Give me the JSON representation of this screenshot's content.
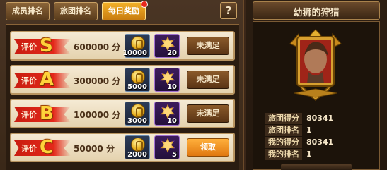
{
  "tabs": [
    {
      "label": "成员排名"
    },
    {
      "label": "旅团排名"
    },
    {
      "label": "每日奖励",
      "active": true
    }
  ],
  "help_label": "?",
  "rewards": [
    {
      "grade_label": "评价",
      "grade": "S",
      "score": "600000",
      "unit": "分",
      "gold_qty": "10000",
      "medal_qty": "20",
      "action": "未满足"
    },
    {
      "grade_label": "评价",
      "grade": "A",
      "score": "300000",
      "unit": "分",
      "gold_qty": "5000",
      "medal_qty": "10",
      "action": "未满足"
    },
    {
      "grade_label": "评价",
      "grade": "B",
      "score": "100000",
      "unit": "分",
      "gold_qty": "3000",
      "medal_qty": "10",
      "action": "未满足"
    },
    {
      "grade_label": "评价",
      "grade": "C",
      "score": "50000",
      "unit": "分",
      "gold_qty": "2000",
      "medal_qty": "5",
      "action": "领取"
    }
  ],
  "panel": {
    "title": "幼狮的狩猎",
    "stats": [
      {
        "label": "旅团得分",
        "value": "80341"
      },
      {
        "label": "旅团排名",
        "value": "1"
      },
      {
        "label": "我的得分",
        "value": "80341"
      },
      {
        "label": "我的排名",
        "value": "1"
      }
    ]
  },
  "colors": {
    "accent": "#f2b028",
    "ribbon": "#e4281a",
    "claim": "#ff9a24"
  }
}
